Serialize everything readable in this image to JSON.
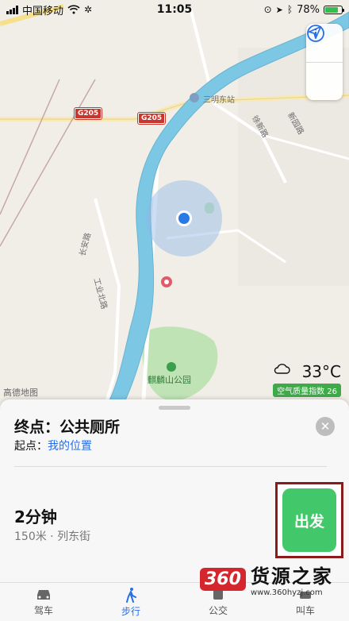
{
  "status_bar": {
    "carrier": "中国移动",
    "time": "11:05",
    "battery": "78%",
    "battery_level": 0.78
  },
  "map": {
    "labels": {
      "station": "三明东站",
      "road_g205_a": "G205",
      "road_g205_b": "G205",
      "road_xuxin": "徐新路",
      "road_xinyuan": "新园路",
      "road_changan": "长安路",
      "road_gongye": "工业北路",
      "park": "麒麟山公园",
      "logo": "高德地图"
    },
    "controls": {
      "info_icon": "info-icon",
      "locate_icon": "location-arrow-icon"
    },
    "weather": {
      "temperature": "33°C",
      "aqi": "空气质量指数 26"
    }
  },
  "route_sheet": {
    "destination": "终点：公共厕所",
    "origin_prefix": "起点：",
    "origin_value": "我的位置",
    "duration": "2分钟",
    "details": "150米 · 列东街",
    "go_label": "出发"
  },
  "tabs": [
    {
      "label": "驾车",
      "icon": "car-icon"
    },
    {
      "label": "步行",
      "icon": "walk-icon",
      "active": true
    },
    {
      "label": "公交",
      "icon": "bus-icon"
    },
    {
      "label": "叫车",
      "icon": "taxi-icon"
    }
  ],
  "watermark": {
    "badge": "360",
    "title": "货源之家",
    "url": "www.360hyzj.com"
  },
  "colors": {
    "accent": "#2a6ee6",
    "go_button": "#42c86a",
    "river": "#7cc8e4",
    "park": "#bfe3b5"
  }
}
